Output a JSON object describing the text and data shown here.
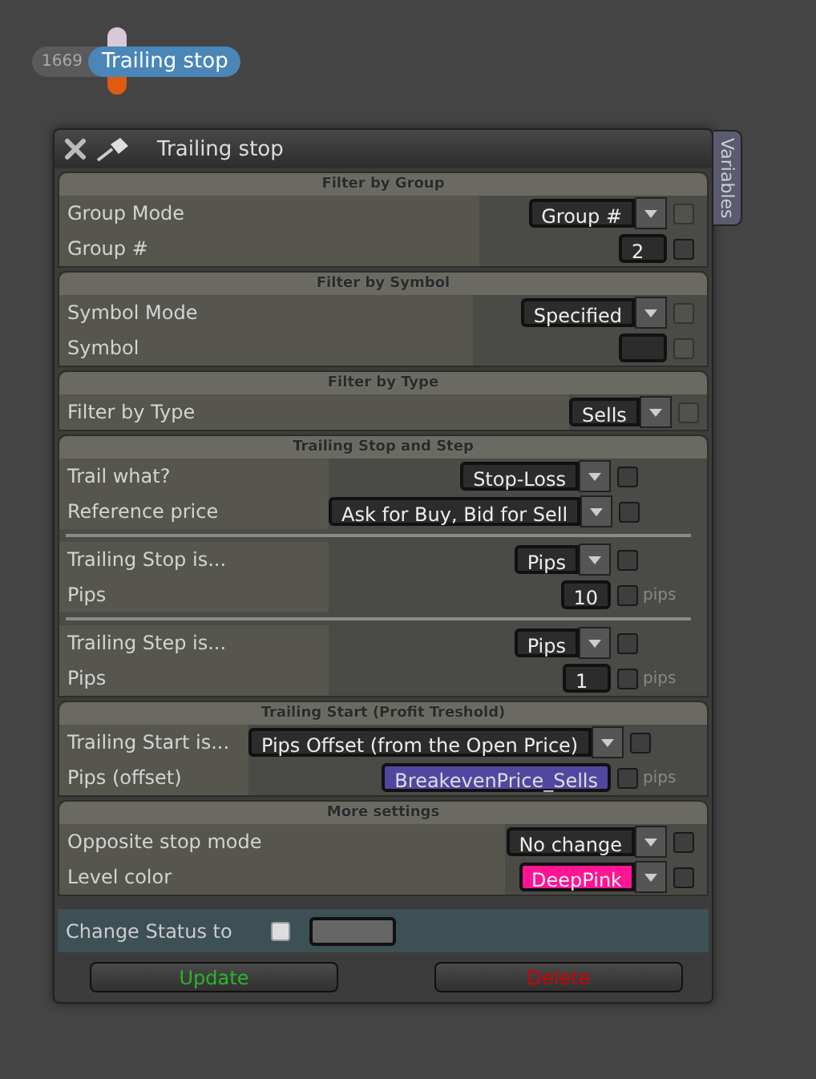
{
  "badge": {
    "number": "1669",
    "label": "Trailing stop"
  },
  "window": {
    "title": "Trailing stop",
    "side_tab": "Variables"
  },
  "sections": [
    {
      "title": "Filter by Group",
      "groups": [
        {
          "rows": [
            {
              "label": "Group Mode",
              "kind": "dropdown",
              "value": "Group #",
              "checkbox_disabled": true
            },
            {
              "label": "Group #",
              "kind": "input",
              "value": "2",
              "checkbox_disabled": false
            }
          ]
        }
      ]
    },
    {
      "title": "Filter by Symbol",
      "groups": [
        {
          "rows": [
            {
              "label": "Symbol Mode",
              "kind": "dropdown",
              "value": "Specified",
              "checkbox_disabled": true
            },
            {
              "label": "Symbol",
              "kind": "input",
              "checkbox_disabled": true
            }
          ]
        }
      ]
    },
    {
      "title": "Filter by Type",
      "groups": [
        {
          "rows": [
            {
              "label": "Filter by Type",
              "kind": "dropdown",
              "value": "Sells",
              "checkbox_disabled": true
            }
          ]
        }
      ]
    },
    {
      "title": "Trailing Stop and Step",
      "groups": [
        {
          "rows": [
            {
              "label": "Trail what?",
              "kind": "dropdown",
              "value": "Stop-Loss",
              "checkbox_disabled": false
            },
            {
              "label": "Reference price",
              "kind": "dropdown",
              "value": "Ask for Buy, Bid for Sell",
              "checkbox_disabled": false
            }
          ]
        },
        {
          "rows": [
            {
              "label": "Trailing Stop is...",
              "kind": "dropdown",
              "value": "Pips",
              "checkbox_disabled": false
            },
            {
              "label": "Pips",
              "kind": "input",
              "value": "10",
              "checkbox_disabled": false,
              "unit": "pips"
            }
          ]
        },
        {
          "rows": [
            {
              "label": "Trailing Step is...",
              "kind": "dropdown",
              "value": "Pips",
              "checkbox_disabled": false
            },
            {
              "label": "Pips",
              "kind": "input",
              "value": "1",
              "checkbox_disabled": false,
              "unit": "pips"
            }
          ]
        }
      ]
    },
    {
      "title": "Trailing Start (Profit Treshold)",
      "groups": [
        {
          "rows": [
            {
              "label": "Trailing Start is...",
              "kind": "dropdown",
              "value": "Pips Offset (from the Open Price)",
              "checkbox_disabled": false
            },
            {
              "label": "Pips (offset)",
              "kind": "variable",
              "value": "BreakevenPrice_Sells",
              "checkbox_disabled": false,
              "unit": "pips"
            }
          ]
        }
      ]
    },
    {
      "title": "More settings",
      "groups": [
        {
          "rows": [
            {
              "label": "Opposite stop mode",
              "kind": "dropdown",
              "value": "No change",
              "checkbox_disabled": false
            },
            {
              "label": "Level color",
              "kind": "dropdown",
              "value": "DeepPink",
              "color": "#ff1493",
              "checkbox_disabled": false
            }
          ]
        }
      ]
    }
  ],
  "status": {
    "label": "Change Status to",
    "checked": false
  },
  "buttons": [
    {
      "label": "Update",
      "kind": "confirm"
    },
    {
      "label": "Delete",
      "kind": "danger"
    }
  ]
}
